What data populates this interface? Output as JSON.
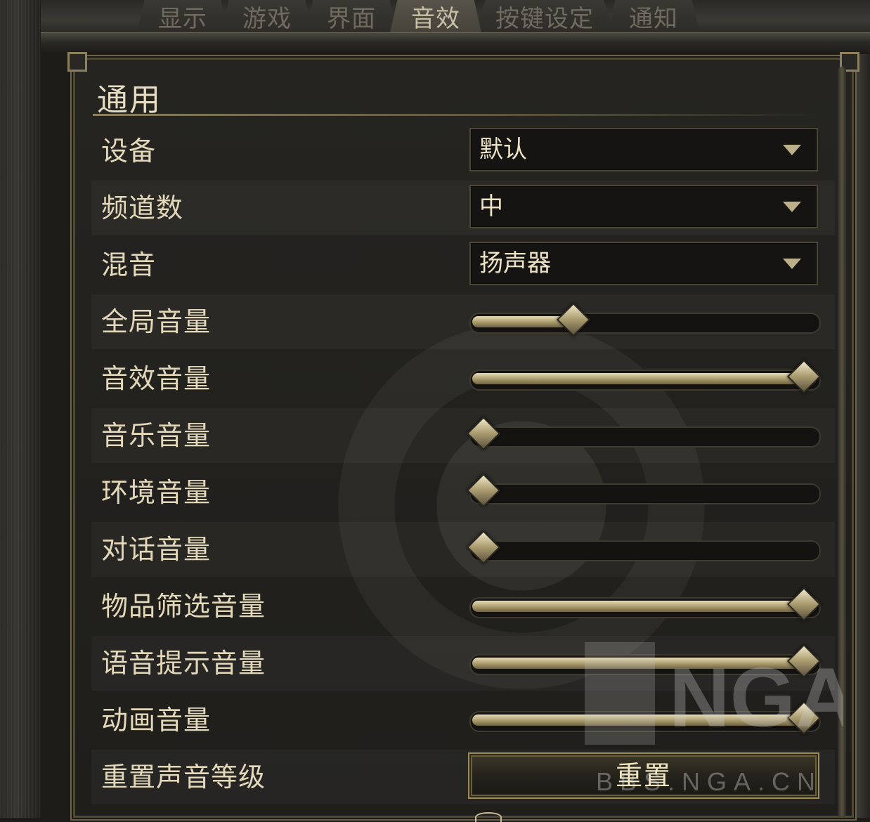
{
  "tabs": [
    {
      "label": "显示",
      "active": false
    },
    {
      "label": "游戏",
      "active": false
    },
    {
      "label": "界面",
      "active": false
    },
    {
      "label": "音效",
      "active": true
    },
    {
      "label": "按键设定",
      "active": false
    },
    {
      "label": "通知",
      "active": false
    }
  ],
  "section": {
    "title": "通用"
  },
  "rows": [
    {
      "label": "设备",
      "type": "dropdown",
      "value": "默认"
    },
    {
      "label": "频道数",
      "type": "dropdown",
      "value": "中"
    },
    {
      "label": "混音",
      "type": "dropdown",
      "value": "扬声器"
    },
    {
      "label": "全局音量",
      "type": "slider",
      "level": 0.28
    },
    {
      "label": "音效音量",
      "type": "slider",
      "level": 1.0
    },
    {
      "label": "音乐音量",
      "type": "slider",
      "level": 0.0
    },
    {
      "label": "环境音量",
      "type": "slider",
      "level": 0.0
    },
    {
      "label": "对话音量",
      "type": "slider",
      "level": 0.0
    },
    {
      "label": "物品筛选音量",
      "type": "slider",
      "level": 1.0
    },
    {
      "label": "语音提示音量",
      "type": "slider",
      "level": 1.0
    },
    {
      "label": "动画音量",
      "type": "slider",
      "level": 1.0
    },
    {
      "label": "重置声音等级",
      "type": "button",
      "button_label": "重置"
    }
  ],
  "watermark": {
    "logo_text": "NGA",
    "site": "BBS.NGA.CN"
  },
  "colors": {
    "accent_gold": "#c9bb8c",
    "label_text": "#e3d8b9",
    "panel_bg": "#1f1e1b"
  }
}
